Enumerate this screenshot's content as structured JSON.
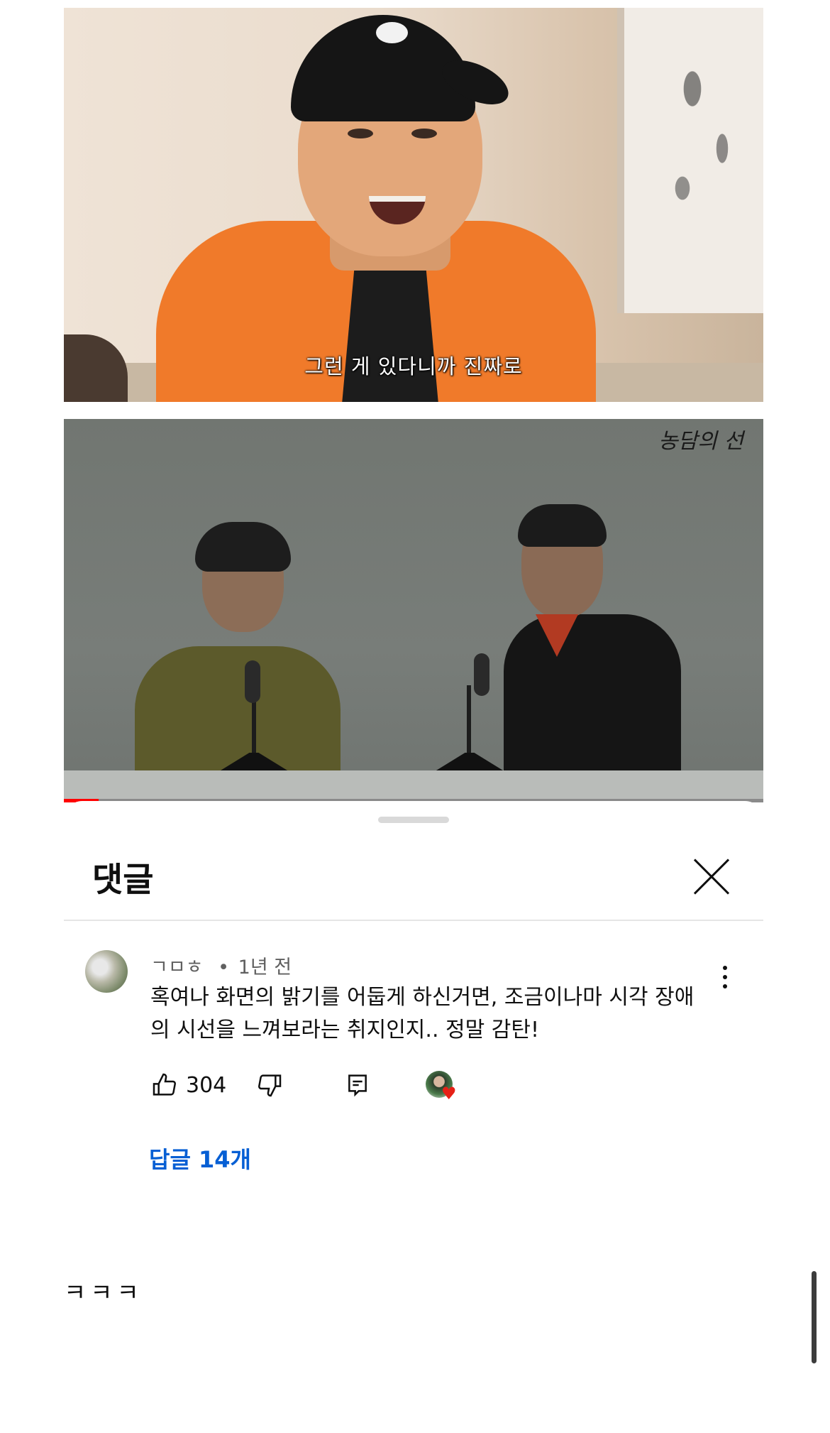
{
  "video_frame_1": {
    "subtitle": "그런 게 있다니까 진짜로"
  },
  "video_frame_2": {
    "watermark": "농담의 선",
    "progress_fraction": 0.05,
    "progress_color": "#ff0000"
  },
  "comments_sheet": {
    "title": "댓글",
    "comment": {
      "author": "ㄱㅁㅎ",
      "separator": "•",
      "time": "1년 전",
      "text": "혹여나 화면의 밝기를 어둡게 하신거면, 조금이나마 시각 장애의 시선을 느껴보라는 취지인지.. 정말 감탄!",
      "likes": "304",
      "creator_heart": true,
      "replies_label": "답글 14개"
    },
    "next_comment_preview": "ㅋㅋㅋ"
  },
  "colors": {
    "link_blue": "#065fd4",
    "heart_red": "#e62117",
    "text_primary": "#0f0f0f",
    "text_secondary": "#606060"
  },
  "icons": [
    "close-icon",
    "more-vert-icon",
    "thumb-up-icon",
    "thumb-down-icon",
    "reply-icon",
    "creator-heart-icon"
  ]
}
